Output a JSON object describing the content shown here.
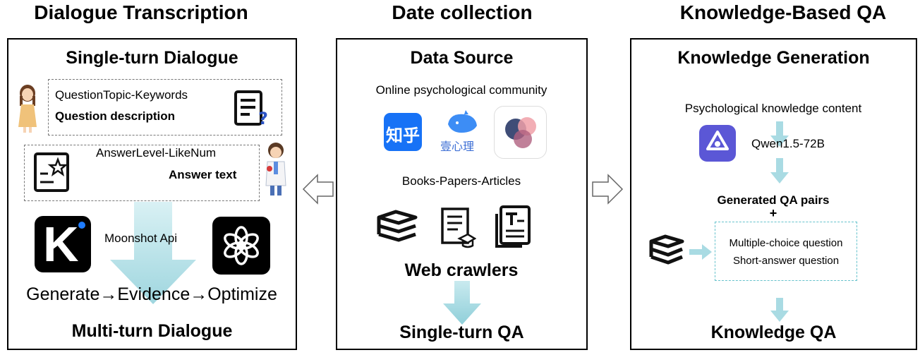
{
  "sections": {
    "left": "Dialogue Transcription",
    "middle": "Date collection",
    "right": "Knowledge-Based QA"
  },
  "left_panel": {
    "title": "Single-turn Dialogue",
    "question_topic": "QuestionTopic-Keywords",
    "question_desc": "Question description",
    "answer_level": "AnswerLevel-LikeNum",
    "answer_text": "Answer text",
    "api": "Moonshot Api",
    "process": "Generate→Evidence→Optimize",
    "bottom": "Multi-turn Dialogue",
    "kimi_logo": "K"
  },
  "middle_panel": {
    "title": "Data Source",
    "community": "Online psychological community",
    "zhihu_logo": "知乎",
    "yixinli_logo": "壹心理",
    "books": "Books-Papers-Articles",
    "crawlers": "Web crawlers",
    "bottom": "Single-turn QA"
  },
  "right_panel": {
    "title": "Knowledge Generation",
    "content": "Psychological knowledge content",
    "model": "Qwen1.5-72B",
    "generated": "Generated QA pairs",
    "plus": "+",
    "mcq": "Multiple-choice question",
    "saq": "Short-answer question",
    "bottom": "Knowledge QA"
  },
  "colors": {
    "arrow_cyan": "#a9dbe3",
    "kimi_blue": "#1e7cff",
    "zhihu_blue": "#1772f6",
    "whale_blue": "#3d8df5",
    "qwen_purple": "#5b57d6"
  }
}
